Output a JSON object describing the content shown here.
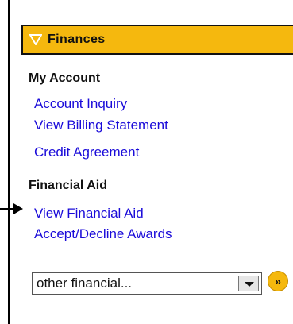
{
  "header": {
    "title": "Finances",
    "icon": "triangle-down-icon"
  },
  "sections": [
    {
      "title": "My Account",
      "links": [
        "Account Inquiry",
        "View Billing Statement",
        "Credit Agreement"
      ]
    },
    {
      "title": "Financial Aid",
      "links": [
        "View Financial Aid",
        "Accept/Decline Awards"
      ]
    }
  ],
  "dropdown": {
    "selected": "other financial..."
  },
  "go_button": {
    "label": "»"
  },
  "colors": {
    "accent": "#f5b80e",
    "link": "#1a0bd9"
  }
}
